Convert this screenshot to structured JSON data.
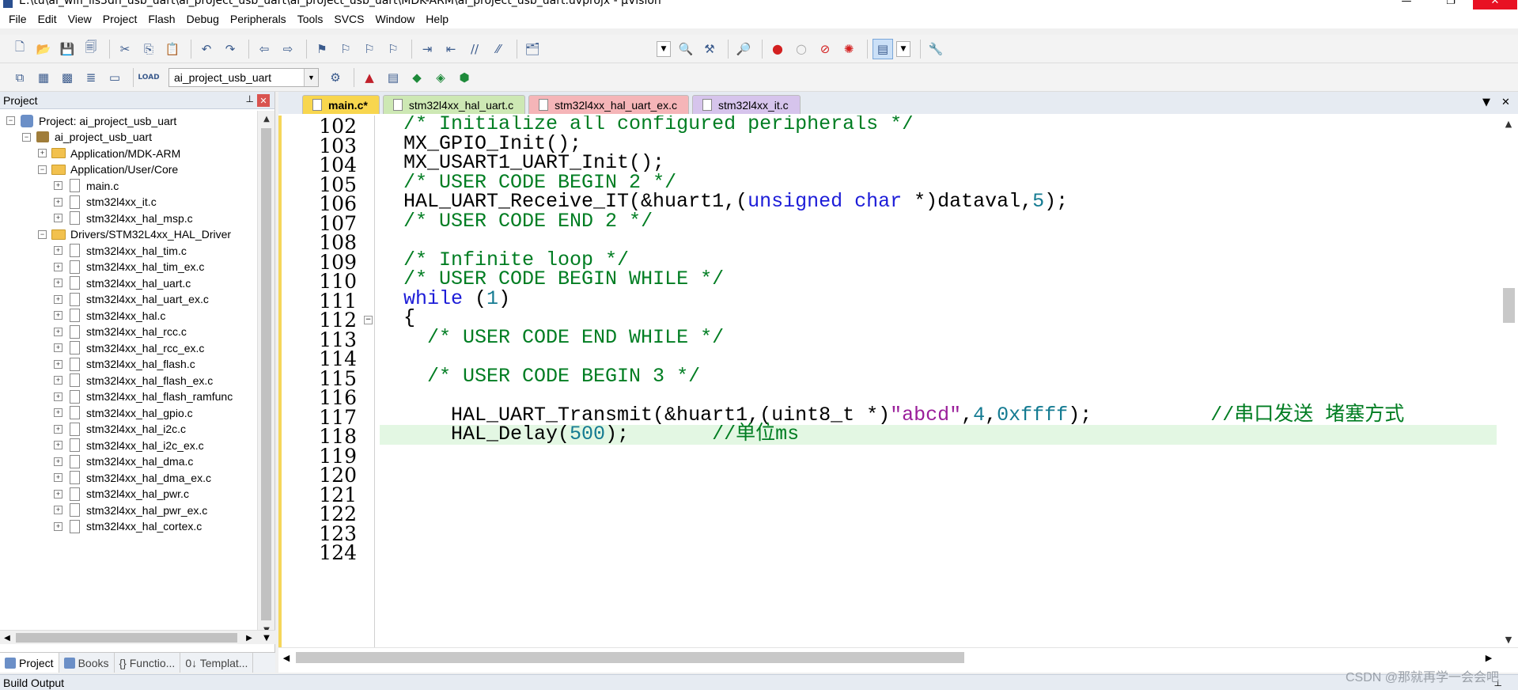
{
  "window": {
    "title": "E:\\tu\\ai_wifi_lis3dh_usb_uart\\ai_project_usb_uart\\ai_project_usb_uart\\MDK-ARM\\ai_project_usb_uart.uvprojx - µVision",
    "minimize": "—",
    "maximize": "❐",
    "close": "✕"
  },
  "menu": [
    "File",
    "Edit",
    "View",
    "Project",
    "Flash",
    "Debug",
    "Peripherals",
    "Tools",
    "SVCS",
    "Window",
    "Help"
  ],
  "toolbar2": {
    "target": "ai_project_usb_uart",
    "load_label": "LOAD"
  },
  "project_panel": {
    "title": "Project",
    "pin": "⊥",
    "close": "✕",
    "tree": [
      {
        "label": "Project: ai_project_usb_uart",
        "level": 0,
        "icon": "project-icon",
        "exp": "−"
      },
      {
        "label": "ai_project_usb_uart",
        "level": 1,
        "icon": "target-icon",
        "exp": "−"
      },
      {
        "label": "Application/MDK-ARM",
        "level": 2,
        "icon": "folder-icon",
        "exp": "+"
      },
      {
        "label": "Application/User/Core",
        "level": 2,
        "icon": "folder-icon",
        "exp": "−"
      },
      {
        "label": "main.c",
        "level": 3,
        "icon": "file-icon",
        "exp": "+"
      },
      {
        "label": "stm32l4xx_it.c",
        "level": 3,
        "icon": "file-icon",
        "exp": "+"
      },
      {
        "label": "stm32l4xx_hal_msp.c",
        "level": 3,
        "icon": "file-icon",
        "exp": "+"
      },
      {
        "label": "Drivers/STM32L4xx_HAL_Driver",
        "level": 2,
        "icon": "folder-icon",
        "exp": "−"
      },
      {
        "label": "stm32l4xx_hal_tim.c",
        "level": 3,
        "icon": "file-icon",
        "exp": "+"
      },
      {
        "label": "stm32l4xx_hal_tim_ex.c",
        "level": 3,
        "icon": "file-icon",
        "exp": "+"
      },
      {
        "label": "stm32l4xx_hal_uart.c",
        "level": 3,
        "icon": "file-icon",
        "exp": "+"
      },
      {
        "label": "stm32l4xx_hal_uart_ex.c",
        "level": 3,
        "icon": "file-icon",
        "exp": "+"
      },
      {
        "label": "stm32l4xx_hal.c",
        "level": 3,
        "icon": "file-icon",
        "exp": "+"
      },
      {
        "label": "stm32l4xx_hal_rcc.c",
        "level": 3,
        "icon": "file-icon",
        "exp": "+"
      },
      {
        "label": "stm32l4xx_hal_rcc_ex.c",
        "level": 3,
        "icon": "file-icon",
        "exp": "+"
      },
      {
        "label": "stm32l4xx_hal_flash.c",
        "level": 3,
        "icon": "file-icon",
        "exp": "+"
      },
      {
        "label": "stm32l4xx_hal_flash_ex.c",
        "level": 3,
        "icon": "file-icon",
        "exp": "+"
      },
      {
        "label": "stm32l4xx_hal_flash_ramfunc",
        "level": 3,
        "icon": "file-icon",
        "exp": "+"
      },
      {
        "label": "stm32l4xx_hal_gpio.c",
        "level": 3,
        "icon": "file-icon",
        "exp": "+"
      },
      {
        "label": "stm32l4xx_hal_i2c.c",
        "level": 3,
        "icon": "file-icon",
        "exp": "+"
      },
      {
        "label": "stm32l4xx_hal_i2c_ex.c",
        "level": 3,
        "icon": "file-icon",
        "exp": "+"
      },
      {
        "label": "stm32l4xx_hal_dma.c",
        "level": 3,
        "icon": "file-icon",
        "exp": "+"
      },
      {
        "label": "stm32l4xx_hal_dma_ex.c",
        "level": 3,
        "icon": "file-icon",
        "exp": "+"
      },
      {
        "label": "stm32l4xx_hal_pwr.c",
        "level": 3,
        "icon": "file-icon",
        "exp": "+"
      },
      {
        "label": "stm32l4xx_hal_pwr_ex.c",
        "level": 3,
        "icon": "file-icon",
        "exp": "+"
      },
      {
        "label": "stm32l4xx_hal_cortex.c",
        "level": 3,
        "icon": "file-icon",
        "exp": "+"
      }
    ],
    "tabs": [
      {
        "label": "Project",
        "active": true
      },
      {
        "label": "Books",
        "active": false
      },
      {
        "label": "{} Functio...",
        "active": false
      },
      {
        "label": "0↓ Templat...",
        "active": false
      }
    ]
  },
  "editor": {
    "tabs": [
      {
        "label": "main.c*",
        "active": true
      },
      {
        "label": "stm32l4xx_hal_uart.c",
        "active": false
      },
      {
        "label": "stm32l4xx_hal_uart_ex.c",
        "active": false
      },
      {
        "label": "stm32l4xx_it.c",
        "active": false
      }
    ],
    "tab_menu": "▼",
    "tab_close": "✕",
    "lines": [
      {
        "n": "102",
        "fold": "",
        "hl": false,
        "spans": [
          {
            "t": "  ",
            "c": ""
          },
          {
            "t": "/* Initialize all configured peripherals */",
            "c": "cm"
          }
        ]
      },
      {
        "n": "103",
        "fold": "",
        "hl": false,
        "spans": [
          {
            "t": "  MX_GPIO_Init();",
            "c": ""
          }
        ]
      },
      {
        "n": "104",
        "fold": "",
        "hl": false,
        "spans": [
          {
            "t": "  MX_USART1_UART_Init();",
            "c": ""
          }
        ]
      },
      {
        "n": "105",
        "fold": "",
        "hl": false,
        "spans": [
          {
            "t": "  ",
            "c": ""
          },
          {
            "t": "/* USER CODE BEGIN 2 */",
            "c": "cm"
          }
        ]
      },
      {
        "n": "106",
        "fold": "",
        "hl": false,
        "spans": [
          {
            "t": "  HAL_UART_Receive_IT(&huart1,(",
            "c": ""
          },
          {
            "t": "unsigned char",
            "c": "kw"
          },
          {
            "t": " *)dataval,",
            "c": ""
          },
          {
            "t": "5",
            "c": "num"
          },
          {
            "t": ");",
            "c": ""
          }
        ]
      },
      {
        "n": "107",
        "fold": "",
        "hl": false,
        "spans": [
          {
            "t": "  ",
            "c": ""
          },
          {
            "t": "/* USER CODE END 2 */",
            "c": "cm"
          }
        ]
      },
      {
        "n": "108",
        "fold": "",
        "hl": false,
        "spans": [
          {
            "t": "",
            "c": ""
          }
        ]
      },
      {
        "n": "109",
        "fold": "",
        "hl": false,
        "spans": [
          {
            "t": "  ",
            "c": ""
          },
          {
            "t": "/* Infinite loop */",
            "c": "cm"
          }
        ]
      },
      {
        "n": "110",
        "fold": "",
        "hl": false,
        "spans": [
          {
            "t": "  ",
            "c": ""
          },
          {
            "t": "/* USER CODE BEGIN WHILE */",
            "c": "cm"
          }
        ]
      },
      {
        "n": "111",
        "fold": "",
        "hl": false,
        "spans": [
          {
            "t": "  ",
            "c": ""
          },
          {
            "t": "while",
            "c": "kw"
          },
          {
            "t": " (",
            "c": ""
          },
          {
            "t": "1",
            "c": "num"
          },
          {
            "t": ")",
            "c": ""
          }
        ]
      },
      {
        "n": "112",
        "fold": "−",
        "hl": false,
        "spans": [
          {
            "t": "  {",
            "c": ""
          }
        ]
      },
      {
        "n": "113",
        "fold": "",
        "hl": false,
        "spans": [
          {
            "t": "    ",
            "c": ""
          },
          {
            "t": "/* USER CODE END WHILE */",
            "c": "cm"
          }
        ]
      },
      {
        "n": "114",
        "fold": "",
        "hl": false,
        "spans": [
          {
            "t": "",
            "c": ""
          }
        ]
      },
      {
        "n": "115",
        "fold": "",
        "hl": false,
        "spans": [
          {
            "t": "    ",
            "c": ""
          },
          {
            "t": "/* USER CODE BEGIN 3 */",
            "c": "cm"
          }
        ]
      },
      {
        "n": "116",
        "fold": "",
        "hl": false,
        "spans": [
          {
            "t": "",
            "c": ""
          }
        ]
      },
      {
        "n": "117",
        "fold": "",
        "hl": false,
        "spans": [
          {
            "t": "      HAL_UART_Transmit(&huart1,(uint8_t *)",
            "c": ""
          },
          {
            "t": "\"abcd\"",
            "c": "str"
          },
          {
            "t": ",",
            "c": ""
          },
          {
            "t": "4",
            "c": "num"
          },
          {
            "t": ",",
            "c": ""
          },
          {
            "t": "0xffff",
            "c": "num"
          },
          {
            "t": ");          ",
            "c": ""
          },
          {
            "t": "//串口发送 堵塞方式",
            "c": "cm"
          }
        ]
      },
      {
        "n": "118",
        "fold": "",
        "hl": true,
        "spans": [
          {
            "t": "      HAL_Delay(",
            "c": ""
          },
          {
            "t": "500",
            "c": "num"
          },
          {
            "t": ");       ",
            "c": ""
          },
          {
            "t": "//单位ms",
            "c": "cm"
          }
        ]
      },
      {
        "n": "119",
        "fold": "",
        "hl": false,
        "spans": [
          {
            "t": "",
            "c": ""
          }
        ]
      },
      {
        "n": "120",
        "fold": "",
        "hl": false,
        "spans": [
          {
            "t": "",
            "c": ""
          }
        ]
      },
      {
        "n": "121",
        "fold": "",
        "hl": false,
        "spans": [
          {
            "t": "",
            "c": ""
          }
        ]
      },
      {
        "n": "122",
        "fold": "",
        "hl": false,
        "spans": [
          {
            "t": "",
            "c": ""
          }
        ]
      },
      {
        "n": "123",
        "fold": "",
        "hl": false,
        "spans": [
          {
            "t": "",
            "c": ""
          }
        ]
      },
      {
        "n": "124",
        "fold": "",
        "hl": false,
        "spans": [
          {
            "t": "",
            "c": ""
          }
        ]
      }
    ]
  },
  "build_output": {
    "title": "Build Output",
    "pin": "⊥"
  },
  "watermark": "CSDN @那就再学一会会吧"
}
